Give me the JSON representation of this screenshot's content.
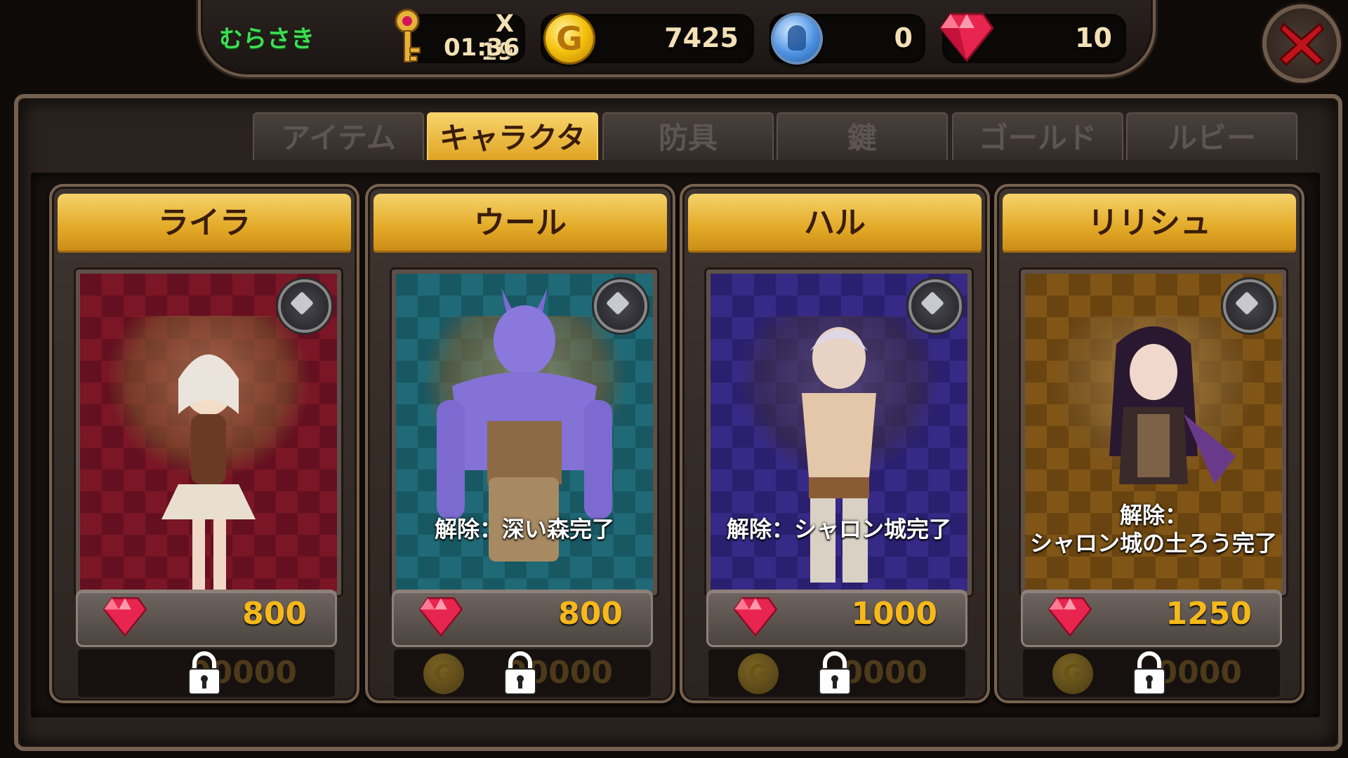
{
  "player": {
    "name": "むらさき"
  },
  "currencies": {
    "keys": {
      "count": "X 19",
      "timer": "01:36",
      "icon": "key-icon"
    },
    "gold": {
      "value": "7425",
      "icon": "gold-coin-icon",
      "coin_letter": "G"
    },
    "spirit": {
      "value": "0",
      "icon": "spirit-orb-icon"
    },
    "ruby": {
      "value": "10",
      "icon": "ruby-gem-icon"
    }
  },
  "tabs": [
    {
      "label": "アイテム",
      "active": false
    },
    {
      "label": "キャラクター",
      "active": true
    },
    {
      "label": "防具",
      "active": false
    },
    {
      "label": "鍵",
      "active": false
    },
    {
      "label": "ゴールド",
      "active": false
    },
    {
      "label": "ルビー",
      "active": false
    }
  ],
  "characters": [
    {
      "name": "ライラ",
      "unlock_line1": "",
      "unlock_line2": "",
      "ruby_price": "800",
      "gold_price": "00000",
      "bg": "#7a1626",
      "locked": true
    },
    {
      "name": "ウール",
      "unlock_line1": "解除：深い森完了",
      "unlock_line2": "",
      "ruby_price": "800",
      "gold_price": "00000",
      "bg": "#1f6a76",
      "locked": true
    },
    {
      "name": "ハル",
      "unlock_line1": "解除：シャロン城完了",
      "unlock_line2": "",
      "ruby_price": "1000",
      "gold_price": "0000",
      "bg": "#372a86",
      "locked": true
    },
    {
      "name": "リリシュ",
      "unlock_line1": "解除：",
      "unlock_line2": "シャロン城の土ろう完了",
      "ruby_price": "1250",
      "gold_price": "0000",
      "bg": "#805516",
      "locked": true
    }
  ],
  "colors": {
    "accent_gold": "#e2a826",
    "ruby": "#f6b81a",
    "player_name": "#3dde52",
    "close": "#c0141a"
  }
}
